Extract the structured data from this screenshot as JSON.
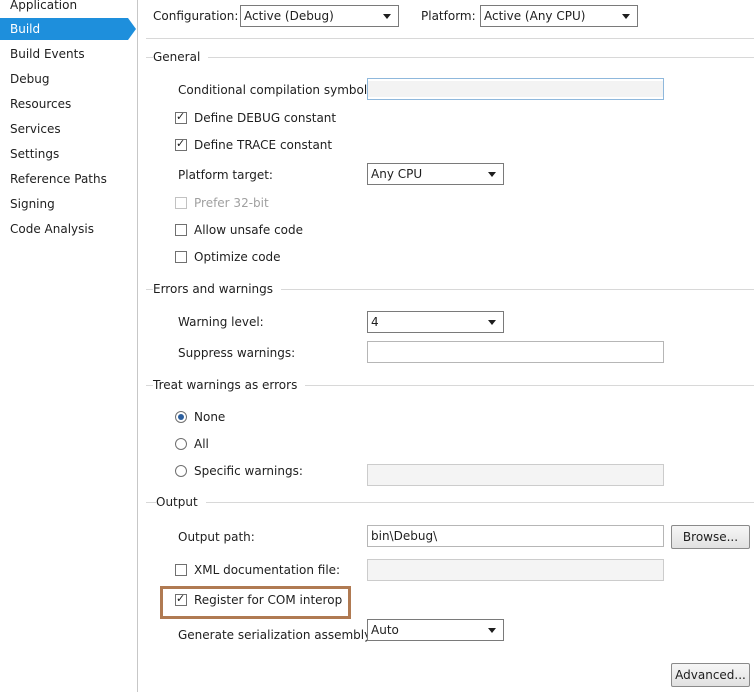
{
  "sidebar": {
    "items": [
      {
        "label": "Application"
      },
      {
        "label": "Build"
      },
      {
        "label": "Build Events"
      },
      {
        "label": "Debug"
      },
      {
        "label": "Resources"
      },
      {
        "label": "Services"
      },
      {
        "label": "Settings"
      },
      {
        "label": "Reference Paths"
      },
      {
        "label": "Signing"
      },
      {
        "label": "Code Analysis"
      }
    ],
    "selected": "Build",
    "accent_color": "#1e8fdc"
  },
  "top": {
    "configuration_label": "Configuration:",
    "configuration_value": "Active (Debug)",
    "platform_label": "Platform:",
    "platform_value": "Active (Any CPU)"
  },
  "general": {
    "header": "General",
    "cond_symbols_label": "Conditional compilation symbols:",
    "cond_symbols_value": "",
    "define_debug_label": "Define DEBUG constant",
    "define_debug_checked": true,
    "define_trace_label": "Define TRACE constant",
    "define_trace_checked": true,
    "platform_target_label": "Platform target:",
    "platform_target_value": "Any CPU",
    "prefer32_label": "Prefer 32-bit",
    "prefer32_checked": false,
    "unsafe_label": "Allow unsafe code",
    "unsafe_checked": false,
    "optimize_label": "Optimize code",
    "optimize_checked": false
  },
  "errors": {
    "header": "Errors and warnings",
    "warning_level_label": "Warning level:",
    "warning_level_value": "4",
    "suppress_label": "Suppress warnings:",
    "suppress_value": ""
  },
  "treat": {
    "header": "Treat warnings as errors",
    "none_label": "None",
    "all_label": "All",
    "specific_label": "Specific warnings:",
    "selected": "None",
    "specific_value": ""
  },
  "output": {
    "header": "Output",
    "output_path_label": "Output path:",
    "output_path_value": "bin\\Debug\\",
    "browse_label": "Browse...",
    "xml_doc_label": "XML documentation file:",
    "xml_doc_checked": false,
    "xml_doc_value": "",
    "com_interop_label": "Register for COM interop",
    "com_interop_checked": true,
    "serialization_label": "Generate serialization assembly:",
    "serialization_value": "Auto",
    "advanced_label": "Advanced...",
    "highlight_color": "#b07a52"
  }
}
